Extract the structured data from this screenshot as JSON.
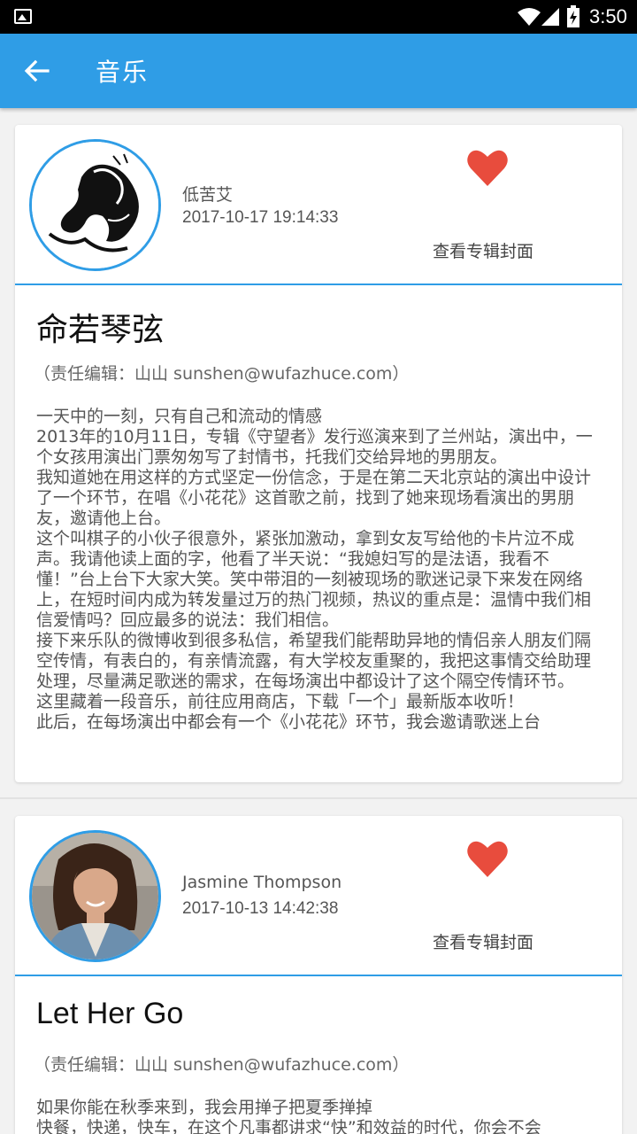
{
  "status_bar": {
    "time": "3:50",
    "icons": [
      "image-icon",
      "wifi-icon",
      "signal-icon",
      "battery-icon"
    ]
  },
  "app_bar": {
    "title": "音乐",
    "back_icon": "arrow-left-icon",
    "background": "#2f9de6"
  },
  "cards": [
    {
      "author": "低苦艾",
      "date": "2017-10-17 19:14:33",
      "cover_link": "查看专辑封面",
      "title": "命若琴弦",
      "editor": "（责任编辑：山山 sunshen@wufazhuce.com）",
      "paragraphs": [
        "一天中的一刻，只有自己和流动的情感",
        "2013年的10月11日，专辑《守望者》发行巡演来到了兰州站，演出中，一个女孩用演出门票匆匆写了封情书，托我们交给异地的男朋友。",
        "我知道她在用这样的方式坚定一份信念，于是在第二天北京站的演出中设计了一个环节，在唱《小花花》这首歌之前，找到了她来现场看演出的男朋友，邀请他上台。",
        "这个叫棋子的小伙子很意外，紧张加激动，拿到女友写给他的卡片泣不成声。我请他读上面的字，他看了半天说：“我媳妇写的是法语，我看不懂！”台上台下大家大笑。笑中带泪的一刻被现场的歌迷记录下来发在网络上，在短时间内成为转发量过万的热门视频，热议的重点是：温情中我们相信爱情吗？回应最多的说法：我们相信。",
        "接下来乐队的微博收到很多私信，希望我们能帮助异地的情侣亲人朋友们隔空传情，有表白的，有亲情流露，有大学校友重聚的，我把这事情交给助理处理，尽量满足歌迷的需求，在每场演出中都设计了这个隔空传情环节。",
        "这里藏着一段音乐，前往应用商店，下载「一个」最新版本收听！",
        "此后，在每场演出中都会有一个《小花花》环节，我会邀请歌迷上台"
      ]
    },
    {
      "author": "Jasmine Thompson",
      "date": "2017-10-13 14:42:38",
      "cover_link": "查看专辑封面",
      "title": "Let Her Go",
      "editor": "（责任编辑：山山 sunshen@wufazhuce.com）",
      "paragraphs": [
        "如果你能在秋季来到，我会用掸子把夏季掸掉",
        "快餐，快递，快车，在这个凡事都讲求“快”和效益的时代，你会不会"
      ]
    }
  ],
  "colors": {
    "accent": "#2f9de6",
    "heart": "#e84c3d"
  }
}
